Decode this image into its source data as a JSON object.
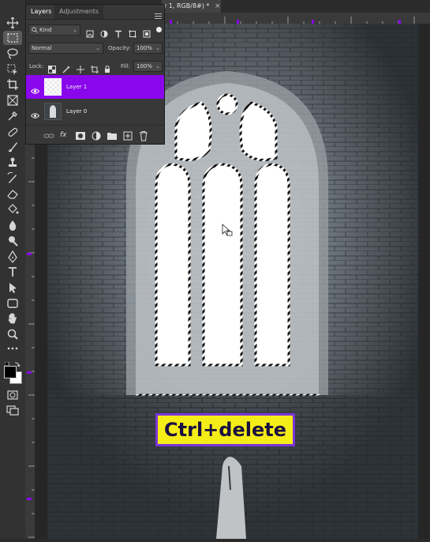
{
  "document": {
    "tab_title": "r 1, RGB/8#) *",
    "close_glyph": "×"
  },
  "panel": {
    "tabs": [
      "Layers",
      "Adjustments"
    ],
    "filter_kind": "Kind",
    "blend_mode": "Normal",
    "opacity_label": "Opacity:",
    "opacity_value": "100%",
    "lock_label": "Lock:",
    "fill_label": "Fill:",
    "fill_value": "100%",
    "layers": [
      {
        "name": "Layer 1",
        "selected": true
      },
      {
        "name": "Layer 0",
        "selected": false
      }
    ]
  },
  "caption": {
    "text": "Ctrl+delete"
  },
  "colors": {
    "accent": "#8a07ec",
    "caption_bg": "#f5ed17",
    "caption_border": "#7a35d8"
  },
  "tools": [
    "move-icon",
    "marquee-icon",
    "lasso-icon",
    "object-select-icon",
    "crop-icon",
    "frame-icon",
    "eyedropper-icon",
    "healing-icon",
    "brush-icon",
    "stamp-icon",
    "history-brush-icon",
    "eraser-icon",
    "paint-bucket-icon",
    "blur-icon",
    "dodge-icon",
    "pen-icon",
    "type-icon",
    "path-select-icon",
    "shape-icon",
    "hand-icon",
    "zoom-icon",
    "more-icon"
  ]
}
